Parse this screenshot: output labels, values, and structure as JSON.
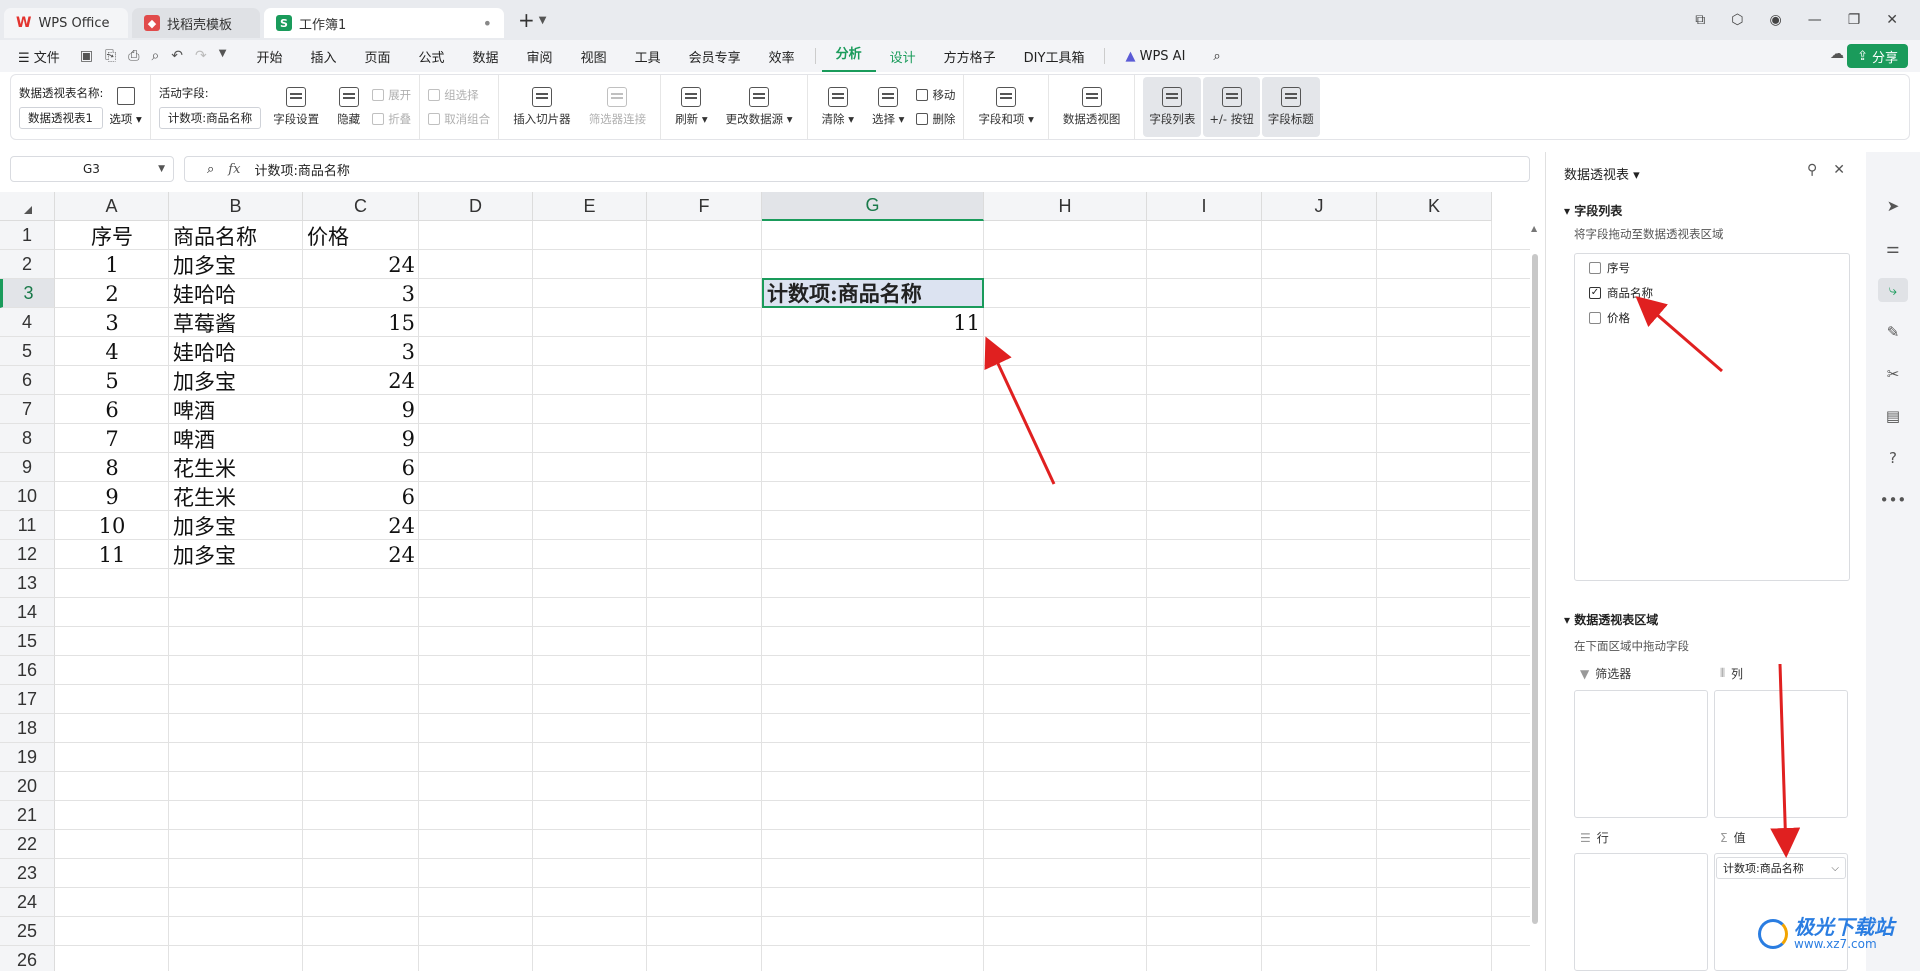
{
  "titlebar": {
    "tabs": [
      {
        "label": "WPS Office"
      },
      {
        "label": "找稻壳模板"
      },
      {
        "label": "工作簿1",
        "icon": "S"
      }
    ]
  },
  "menubar": {
    "file": "文件",
    "items": [
      "开始",
      "插入",
      "页面",
      "公式",
      "数据",
      "审阅",
      "视图",
      "工具",
      "会员专享",
      "效率"
    ],
    "active": "分析",
    "design": "设计",
    "extras": [
      "方方格子",
      "DIY工具箱"
    ],
    "wps_ai": "WPS AI",
    "share": "分享"
  },
  "ribbon": {
    "pivot_name_label": "数据透视表名称:",
    "pivot_name_value": "数据透视表1",
    "options": "选项",
    "active_field_label": "活动字段:",
    "active_field_value": "计数项:商品名称",
    "field_settings": "字段设置",
    "hide": "隐藏",
    "expand": "展开",
    "collapse": "折叠",
    "group_select": "组选择",
    "ungroup": "取消组合",
    "insert_slicer": "插入切片器",
    "filter_conn": "筛选器连接",
    "refresh": "刷新",
    "change_source": "更改数据源",
    "clear": "清除",
    "select": "选择",
    "move": "移动",
    "delete": "删除",
    "fields_items": "字段和项",
    "pivot_view": "数据透视图",
    "field_list": "字段列表",
    "plus_minus": "+/- 按钮",
    "field_header": "字段标题"
  },
  "formula": {
    "cell_ref": "G3",
    "content": "计数项:商品名称"
  },
  "columns": [
    "A",
    "B",
    "C",
    "D",
    "E",
    "F",
    "G",
    "H",
    "I",
    "J",
    "K"
  ],
  "rows": [
    "1",
    "2",
    "3",
    "4",
    "5",
    "6",
    "7",
    "8",
    "9",
    "10",
    "11",
    "12",
    "13",
    "14",
    "15",
    "16",
    "17",
    "18",
    "19",
    "20",
    "21",
    "22",
    "23",
    "24",
    "25",
    "26"
  ],
  "table": {
    "headers": [
      "序号",
      "商品名称",
      "价格"
    ],
    "data": [
      [
        "1",
        "加多宝",
        "24"
      ],
      [
        "2",
        "娃哈哈",
        "3"
      ],
      [
        "3",
        "草莓酱",
        "15"
      ],
      [
        "4",
        "娃哈哈",
        "3"
      ],
      [
        "5",
        "加多宝",
        "24"
      ],
      [
        "6",
        "啤酒",
        "9"
      ],
      [
        "7",
        "啤酒",
        "9"
      ],
      [
        "8",
        "花生米",
        "6"
      ],
      [
        "9",
        "花生米",
        "6"
      ],
      [
        "10",
        "加多宝",
        "24"
      ],
      [
        "11",
        "加多宝",
        "24"
      ]
    ]
  },
  "pivot": {
    "header": "计数项:商品名称",
    "value": "11"
  },
  "panel": {
    "title": "数据透视表",
    "field_list_title": "字段列表",
    "field_list_hint": "将字段拖动至数据透视表区域",
    "fields": [
      {
        "label": "序号",
        "checked": false
      },
      {
        "label": "商品名称",
        "checked": true
      },
      {
        "label": "价格",
        "checked": false
      }
    ],
    "areas_title": "数据透视表区域",
    "areas_hint": "在下面区域中拖动字段",
    "filter": "筛选器",
    "column": "列",
    "row": "行",
    "values": "值",
    "value_chip": "计数项:商品名称"
  },
  "watermark": {
    "main": "极光下载站",
    "url": "www.xz7.com"
  },
  "colors": {
    "accent": "#1a9b5b",
    "arrow": "#e02020",
    "selection_fill": "#dce3f1"
  }
}
